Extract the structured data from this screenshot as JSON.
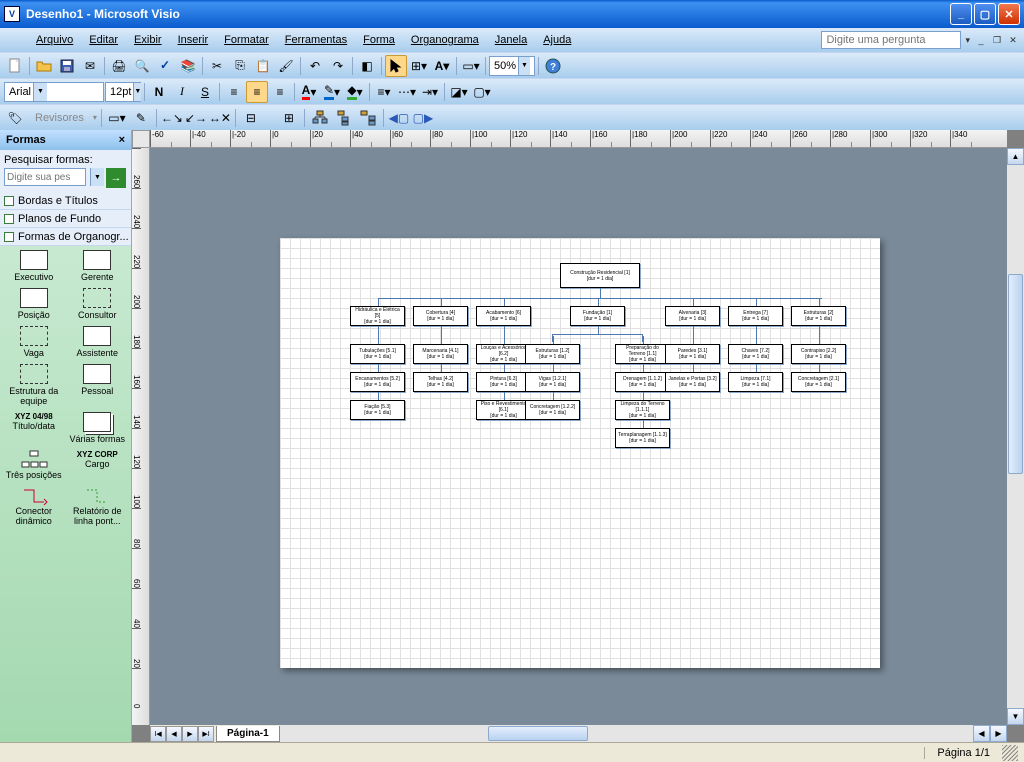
{
  "titlebar": {
    "title": "Desenho1 - Microsoft Visio"
  },
  "menu": {
    "file": "Arquivo",
    "edit": "Editar",
    "view": "Exibir",
    "insert": "Inserir",
    "format": "Formatar",
    "tools": "Ferramentas",
    "shape": "Forma",
    "orgchart": "Organograma",
    "window": "Janela",
    "help": "Ajuda",
    "help_placeholder": "Digite uma pergunta"
  },
  "format_toolbar": {
    "font": "Arial",
    "size": "12pt",
    "zoom": "50%"
  },
  "reviewers": {
    "label": "Revisores"
  },
  "shapes_panel": {
    "title": "Formas",
    "search_label": "Pesquisar formas:",
    "search_placeholder": "Digite sua pes",
    "stencils": [
      "Bordas e Títulos",
      "Planos de Fundo",
      "Formas de Organogr..."
    ],
    "shapes": [
      "Executivo",
      "Gerente",
      "Posição",
      "Consultor",
      "Vaga",
      "Assistente",
      "Estrutura da equipe",
      "Pessoal",
      "Título/data",
      "Várias formas",
      "Três posições",
      "Cargo",
      "Conector dinâmico",
      "Relatório de linha pont..."
    ],
    "shape_extra": {
      "titulo_data": "XYZ 04/98",
      "cargo": "XYZ CORP"
    }
  },
  "ruler_h": [
    "-60",
    "|-40",
    "|-20",
    "|0",
    "|20",
    "|40",
    "|60",
    "|80",
    "|100",
    "|120",
    "|140",
    "|160",
    "|180",
    "|200",
    "|220",
    "|240",
    "|260",
    "|280",
    "|300",
    "|320",
    "|340"
  ],
  "ruler_v": [
    "260",
    "240",
    "220",
    "200",
    "180",
    "160",
    "140",
    "120",
    "100",
    "80",
    "60",
    "40",
    "20",
    "0"
  ],
  "chart_data": {
    "type": "org-chart",
    "duration_label": "[dur = 1 dia]",
    "root": {
      "title": "Construção Residencial [1]"
    },
    "level2": [
      {
        "title": "Hidráulica e Elétrica [5]"
      },
      {
        "title": "Cobertura [4]"
      },
      {
        "title": "Acabamento [6]"
      },
      {
        "title": "Fundação [1]"
      },
      {
        "title": "Alvenaria [3]"
      },
      {
        "title": "Entrega [7]"
      },
      {
        "title": "Estruturas [2]"
      }
    ],
    "col_hidraulica": [
      {
        "title": "Tubulações [5.1]"
      },
      {
        "title": "Encanamentos [5.2]"
      },
      {
        "title": "Fiação [5.3]"
      }
    ],
    "col_cobertura": [
      {
        "title": "Marcenaria [4.1]"
      },
      {
        "title": "Telhas [4.2]"
      }
    ],
    "col_acabamento": [
      {
        "title": "Louças e Acessórios [6.2]"
      },
      {
        "title": "Pintura [6.3]"
      },
      {
        "title": "Piso e Revestimento [6.1]"
      }
    ],
    "col_fundacao_left": [
      {
        "title": "Estruturas [1.2]"
      },
      {
        "title": "Vigas [1.2.1]"
      },
      {
        "title": "Concretagem [1.2.2]"
      }
    ],
    "col_fundacao_right": [
      {
        "title": "Preparação do Terreno [1.1]"
      },
      {
        "title": "Drenagem [1.1.2]"
      },
      {
        "title": "Limpeza do Terreno [1.1.1]"
      },
      {
        "title": "Terraplanagem [1.1.3]"
      }
    ],
    "col_alvenaria": [
      {
        "title": "Paredes [3.1]"
      },
      {
        "title": "Janelas e Portas [3.2]"
      }
    ],
    "col_entrega": [
      {
        "title": "Chaves [7.2]"
      },
      {
        "title": "Limpeza [7.1]"
      }
    ],
    "col_estruturas": [
      {
        "title": "Contrapiso [2.2]"
      },
      {
        "title": "Concretagem [2.1]"
      }
    ]
  },
  "page_tabs": {
    "page1": "Página-1"
  },
  "statusbar": {
    "page": "Página 1/1"
  }
}
